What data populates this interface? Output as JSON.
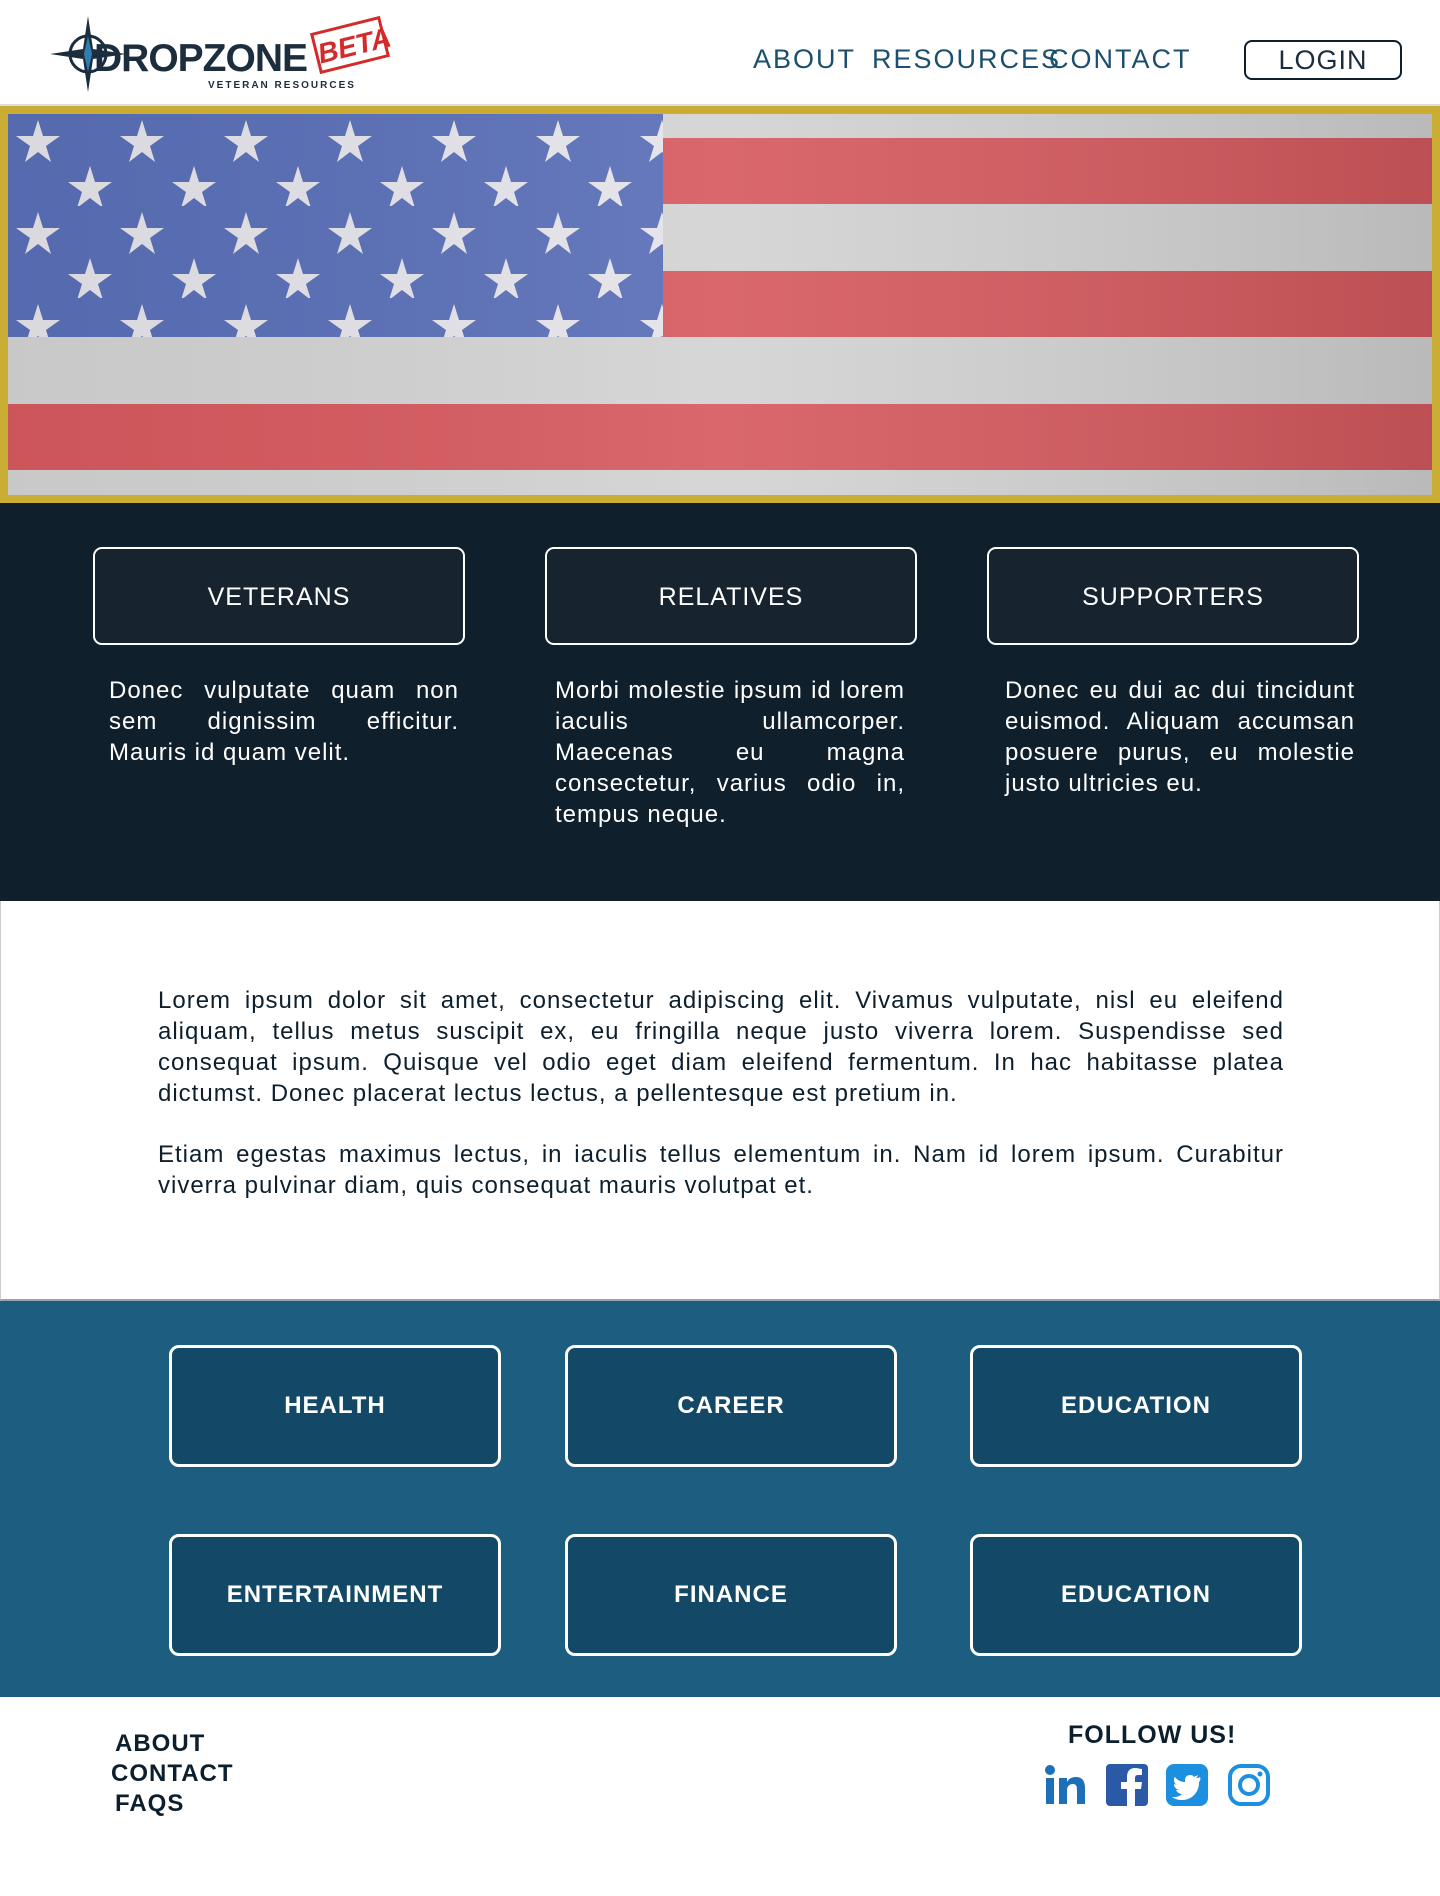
{
  "brand": {
    "name": "DROPZONE",
    "tagline": "VETERAN RESOURCES",
    "badge": "BETA",
    "colors": {
      "navy": "#0f1f2c",
      "blue": "#1d5d80",
      "gold": "#c9ad34",
      "red": "#d42a2a"
    }
  },
  "nav": {
    "items": [
      "ABOUT",
      "RESOURCES",
      "CONTACT"
    ],
    "login": "LOGIN"
  },
  "hero": {
    "image": "american-flag"
  },
  "audience": [
    {
      "label": "VETERANS",
      "text": "Donec vulputate quam non sem dignissim efficitur. Mauris id quam velit."
    },
    {
      "label": "RELATIVES",
      "text": "Morbi molestie ipsum id lorem iaculis ullamcorper. Maecenas eu magna consectetur, varius odio in, tempus neque."
    },
    {
      "label": "SUPPORTERS",
      "text": "Donec eu dui ac dui tincidunt euismod. Aliquam accumsan posuere purus, eu molestie justo ultricies eu."
    }
  ],
  "intro": {
    "paragraphs": [
      "Lorem ipsum dolor sit amet, consectetur adipiscing elit. Vivamus vulputate, nisl eu eleifend aliquam, tellus metus suscipit ex, eu fringilla neque justo viverra lorem. Suspendisse sed consequat ipsum. Quisque vel odio eget diam eleifend fermentum. In hac habitasse platea dictumst. Donec placerat lectus lectus, a pellentesque est pretium in.",
      "Etiam egestas maximus lectus, in iaculis tellus elementum in. Nam id lorem ipsum. Curabitur viverra pulvinar diam, quis consequat mauris volutpat et."
    ]
  },
  "categories": [
    "HEALTH",
    "CAREER",
    "EDUCATION",
    "ENTERTAINMENT",
    "FINANCE",
    "EDUCATION"
  ],
  "footer": {
    "links": [
      "ABOUT",
      "CONTACT",
      "FAQS"
    ],
    "follow": "FOLLOW US!",
    "social": [
      "linkedin-icon",
      "facebook-icon",
      "twitter-icon",
      "instagram-icon"
    ]
  }
}
